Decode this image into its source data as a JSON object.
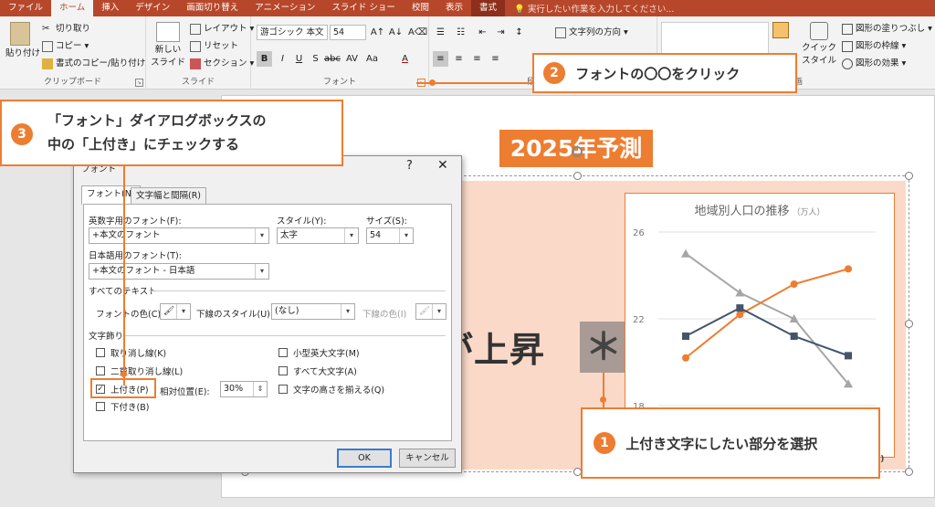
{
  "tabs": [
    "ファイル",
    "ホーム",
    "挿入",
    "デザイン",
    "画面切り替え",
    "アニメーション",
    "スライド ショー",
    "校閲",
    "表示",
    "書式"
  ],
  "active_tab": "ホーム",
  "search_placeholder": "実行したい作業を入力してください...",
  "ribbon": {
    "clipboard": {
      "paste": "貼り付け",
      "cut": "切り取り",
      "copy": "コピー",
      "format_painter": "書式のコピー/貼り付け",
      "label": "クリップボード"
    },
    "slides": {
      "new_slide_1": "新しい",
      "new_slide_2": "スライド",
      "layout": "レイアウト",
      "reset": "リセット",
      "section": "セクション",
      "label": "スライド"
    },
    "font": {
      "font_name": "游ゴシック 本文",
      "font_size": "54",
      "label": "フォント"
    },
    "paragraph": {
      "text_direction": "文字列の方向",
      "label_partial": "段"
    },
    "drawing": {
      "quick_style_1": "クイック",
      "quick_style_2": "スタイル",
      "shape_fill": "図形の塗りつぶし",
      "shape_outline": "図形の枠線",
      "shape_effects": "図形の効果",
      "label_partial": "画"
    }
  },
  "slide": {
    "title": "2025年予測",
    "big_text": "が上昇",
    "asterisk": "＊"
  },
  "chart_data": {
    "type": "line",
    "title": "地域別人口の推移",
    "unit": "（万人）",
    "y_ticks": [
      "26",
      "22",
      "18"
    ],
    "ylim": [
      18,
      26
    ],
    "x": [
      0,
      1,
      2,
      3
    ],
    "series": [
      {
        "values": [
          25,
          23.2,
          22,
          19
        ],
        "color": "#a5a5a5"
      },
      {
        "values": [
          20.2,
          22.2,
          23.6,
          24.3
        ],
        "color": "#ed7d31"
      },
      {
        "values": [
          21.2,
          22.5,
          21.2,
          20.3
        ],
        "color": "#44546a"
      }
    ],
    "legend_fragment": "7)"
  },
  "dialog": {
    "title": "フォント",
    "help": "?",
    "close": "✕",
    "tab_font": "フォント(N)",
    "tab_spacing": "文字幅と間隔(R)",
    "latin_font_label": "英数字用のフォント(F):",
    "latin_font_value": "+本文のフォント",
    "style_label": "スタイル(Y):",
    "style_value": "太字",
    "size_label": "サイズ(S):",
    "size_value": "54",
    "asian_font_label": "日本語用のフォント(T):",
    "asian_font_value": "+本文のフォント - 日本語",
    "all_text_label": "すべてのテキスト",
    "font_color_label": "フォントの色(C)",
    "underline_style_label": "下線のスタイル(U)",
    "underline_style_value": "(なし)",
    "underline_color_label": "下線の色(I)",
    "effects_label": "文字飾り",
    "strikethrough": "取り消し線(K)",
    "double_strikethrough": "二重取り消し線(L)",
    "superscript": "上付き(P)",
    "subscript": "下付き(B)",
    "offset_label": "相対位置(E):",
    "offset_value": "30%",
    "small_caps": "小型英大文字(M)",
    "all_caps": "すべて大文字(A)",
    "equalize_height": "文字の高さを揃える(Q)",
    "ok": "OK",
    "cancel": "キャンセル"
  },
  "callouts": {
    "c1_num": "1",
    "c1_text": "上付き文字にしたい部分を選択",
    "c2_num": "2",
    "c2_text": "フォントの〇〇をクリック",
    "c3_num": "3",
    "c3_line1": "「フォント」ダイアログボックスの",
    "c3_line2": "中の「上付き」にチェックする"
  },
  "colors": {
    "accent": "#ed7d31",
    "ribbon": "#b7472a"
  }
}
